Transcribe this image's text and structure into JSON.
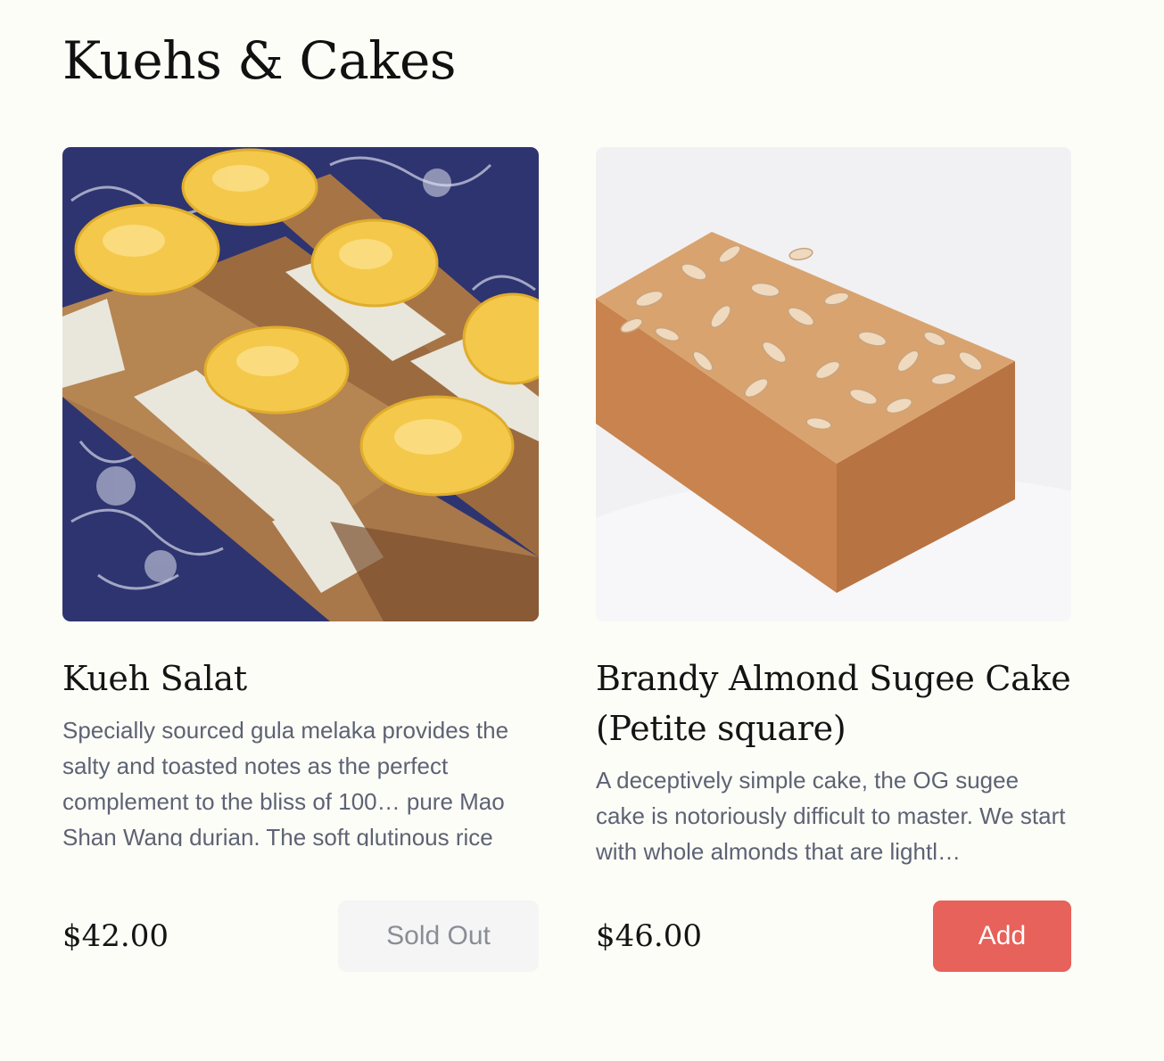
{
  "section": {
    "title": "Kuehs & Cakes"
  },
  "products": [
    {
      "name": "Kueh Salat",
      "description": "Specially sourced gula melaka provides the salty and toasted notes as the perfect complement to the bliss of 100… pure Mao Shan Wang durian. The soft glutinous rice layer is also made with",
      "price": "$42.00",
      "button_label": "Sold Out",
      "image": "kueh-salat-photo"
    },
    {
      "name": "Brandy Almond Sugee Cake (Petite square)",
      "description": "A deceptively simple cake, the OG sugee cake is notoriously difficult to master. We start with whole almonds that are lightl…",
      "price": "$46.00",
      "button_label": "Add",
      "image": "almond-sugee-cake-photo"
    }
  ],
  "colors": {
    "background": "#fdfdf8",
    "add_button": "#e6625a",
    "soldout_button": "#f5f5f5",
    "description_text": "#5d6373"
  }
}
